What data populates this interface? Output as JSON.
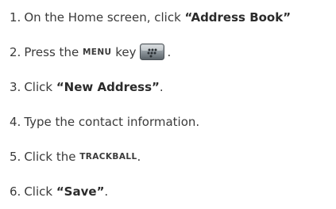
{
  "steps": [
    {
      "num": "1.",
      "pre": "On the Home screen, click ",
      "bold": "“Address Book”",
      "post": ""
    },
    {
      "num": "2.",
      "pre": "Press the ",
      "key": "MENU",
      "post": " key",
      "icon": "blackberry-menu-key-icon",
      "trail": "."
    },
    {
      "num": "3.",
      "pre": "Click ",
      "bold": "“New Address”",
      "post": "."
    },
    {
      "num": "4.",
      "pre": "Type the contact information.",
      "post": ""
    },
    {
      "num": "5.",
      "pre": "Click the ",
      "key": "TRACKBALL",
      "post": "."
    },
    {
      "num": "6.",
      "pre": "Click ",
      "bold": "“Save”",
      "post": "."
    }
  ]
}
